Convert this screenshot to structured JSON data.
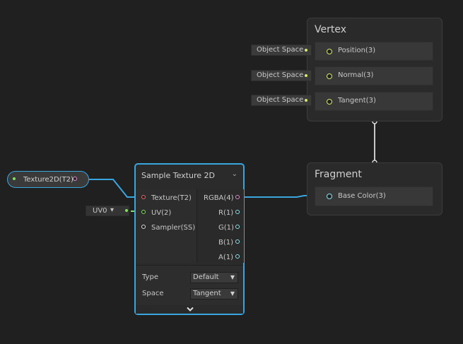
{
  "vertex": {
    "title": "Vertex",
    "slots": [
      {
        "label": "Position(3)",
        "space": "Object Space"
      },
      {
        "label": "Normal(3)",
        "space": "Object Space"
      },
      {
        "label": "Tangent(3)",
        "space": "Object Space"
      }
    ]
  },
  "fragment": {
    "title": "Fragment",
    "slots": [
      {
        "label": "Base Color(3)"
      }
    ]
  },
  "texture_property": {
    "label": "Texture2D(T2)"
  },
  "uv_selector": {
    "value": "UV0",
    "arrow": "▾"
  },
  "sample_texture": {
    "title": "Sample Texture 2D",
    "collapse_icon": "chevron-down-icon",
    "inputs": [
      "Texture(T2)",
      "UV(2)",
      "Sampler(SS)"
    ],
    "outputs": [
      "RGBA(4)",
      "R(1)",
      "G(1)",
      "B(1)",
      "A(1)"
    ],
    "type_label": "Type",
    "type_value": "Default",
    "space_label": "Space",
    "space_value": "Tangent",
    "expand_icon": "chevron-down-icon"
  },
  "colors": {
    "background": "#202020",
    "selection": "#3aa6df",
    "vector3_port": "#d8e86a",
    "vector4_port": "#e58bd0",
    "float_port": "#8de4ef",
    "texture_port": "#e56b6b",
    "vector2_port": "#83e05f"
  }
}
